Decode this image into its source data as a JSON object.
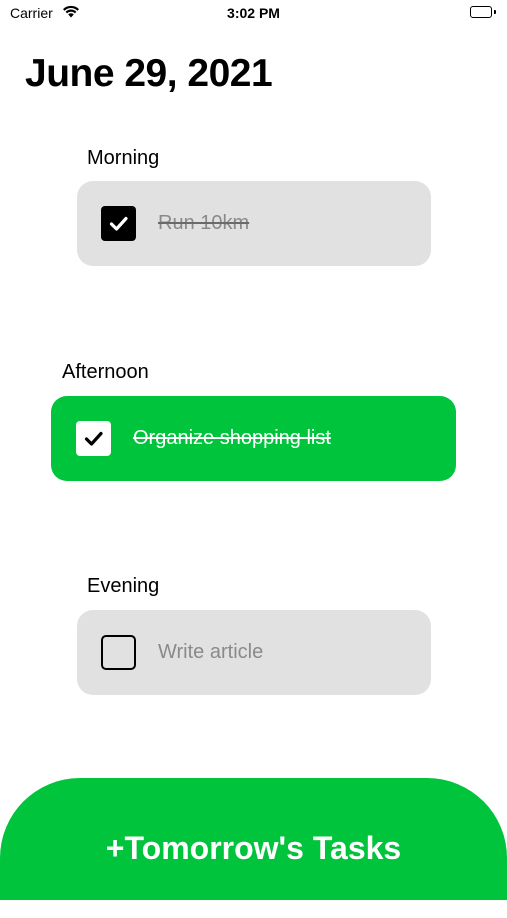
{
  "status_bar": {
    "carrier": "Carrier",
    "time": "3:02 PM"
  },
  "header": {
    "date": "June 29, 2021"
  },
  "sections": [
    {
      "label": "Morning",
      "task": "Run 10km",
      "checked": true
    },
    {
      "label": "Afternoon",
      "task": "Organize shopping list",
      "checked": true
    },
    {
      "label": "Evening",
      "task": "Write article",
      "checked": false
    }
  ],
  "add_button": {
    "label": "+Tomorrow's Tasks"
  },
  "colors": {
    "accent": "#00c43b",
    "card": "#e1e1e1"
  },
  "icons": {
    "wifi": "wifi-icon",
    "battery": "battery-icon",
    "check": "checkmark-icon"
  }
}
